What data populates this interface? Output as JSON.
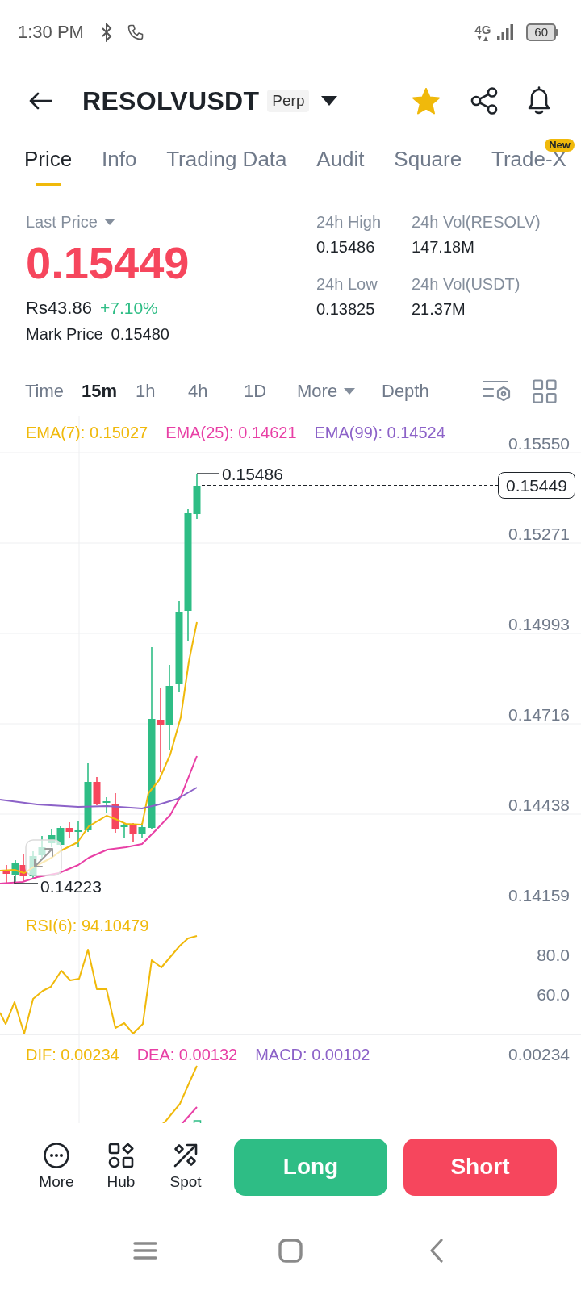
{
  "status_bar": {
    "time": "1:30 PM",
    "network": "4G",
    "battery": "60"
  },
  "header": {
    "symbol": "RESOLVUSDT",
    "tag": "Perp",
    "favorite": true
  },
  "tabs": [
    {
      "label": "Price",
      "selected": true
    },
    {
      "label": "Info",
      "selected": false
    },
    {
      "label": "Trading Data",
      "selected": false
    },
    {
      "label": "Audit",
      "selected": false
    },
    {
      "label": "Square",
      "selected": false
    },
    {
      "label": "Trade-X",
      "selected": false,
      "badge": "New"
    }
  ],
  "ticker": {
    "last_price_label": "Last Price",
    "last_price": "0.15449",
    "local_price": "Rs43.86",
    "change": "+7.10%",
    "mark_price_label": "Mark Price",
    "mark_price": "0.15480",
    "stats": [
      {
        "label": "24h High",
        "value": "0.15486"
      },
      {
        "label": "24h Vol(RESOLV)",
        "value": "147.18M"
      },
      {
        "label": "24h Low",
        "value": "0.13825"
      },
      {
        "label": "24h Vol(USDT)",
        "value": "21.37M"
      }
    ]
  },
  "intervals": [
    {
      "label": "Time",
      "selected": false,
      "kind": "option"
    },
    {
      "label": "15m",
      "selected": true,
      "kind": "option"
    },
    {
      "label": "1h",
      "selected": false,
      "kind": "option"
    },
    {
      "label": "4h",
      "selected": false,
      "kind": "option"
    },
    {
      "label": "1D",
      "selected": false,
      "kind": "option"
    },
    {
      "label": "More",
      "selected": false,
      "kind": "dropdown"
    },
    {
      "label": "Depth",
      "selected": false,
      "kind": "option"
    }
  ],
  "chart": {
    "indicators": [
      {
        "label": "EMA(7): 0.15027",
        "color": "#f0b90b"
      },
      {
        "label": "EMA(25): 0.14621",
        "color": "#e83fa5"
      },
      {
        "label": "EMA(99): 0.14524",
        "color": "#8c62c8"
      }
    ],
    "price_axis": [
      "0.15550",
      "0.15271",
      "0.14993",
      "0.14716",
      "0.14438",
      "0.14159"
    ],
    "high_label": "0.15486",
    "low_label": "0.14223",
    "last_price_tag": "0.15449"
  },
  "rsi": {
    "label": "RSI(6): 94.10479",
    "axis": [
      "80.0",
      "60.0"
    ]
  },
  "macd": {
    "indicators": [
      {
        "label": "DIF: 0.00234",
        "color": "#f0b90b"
      },
      {
        "label": "DEA: 0.00132",
        "color": "#e83fa5"
      },
      {
        "label": "MACD: 0.00102",
        "color": "#8c62c8"
      }
    ],
    "axis": [
      "0.00234"
    ]
  },
  "toolbar": [
    {
      "label": "More"
    },
    {
      "label": "Hub"
    },
    {
      "label": "Spot"
    }
  ],
  "trade_buttons": [
    {
      "label": "Long",
      "kind": "long"
    },
    {
      "label": "Short",
      "kind": "short"
    }
  ]
}
